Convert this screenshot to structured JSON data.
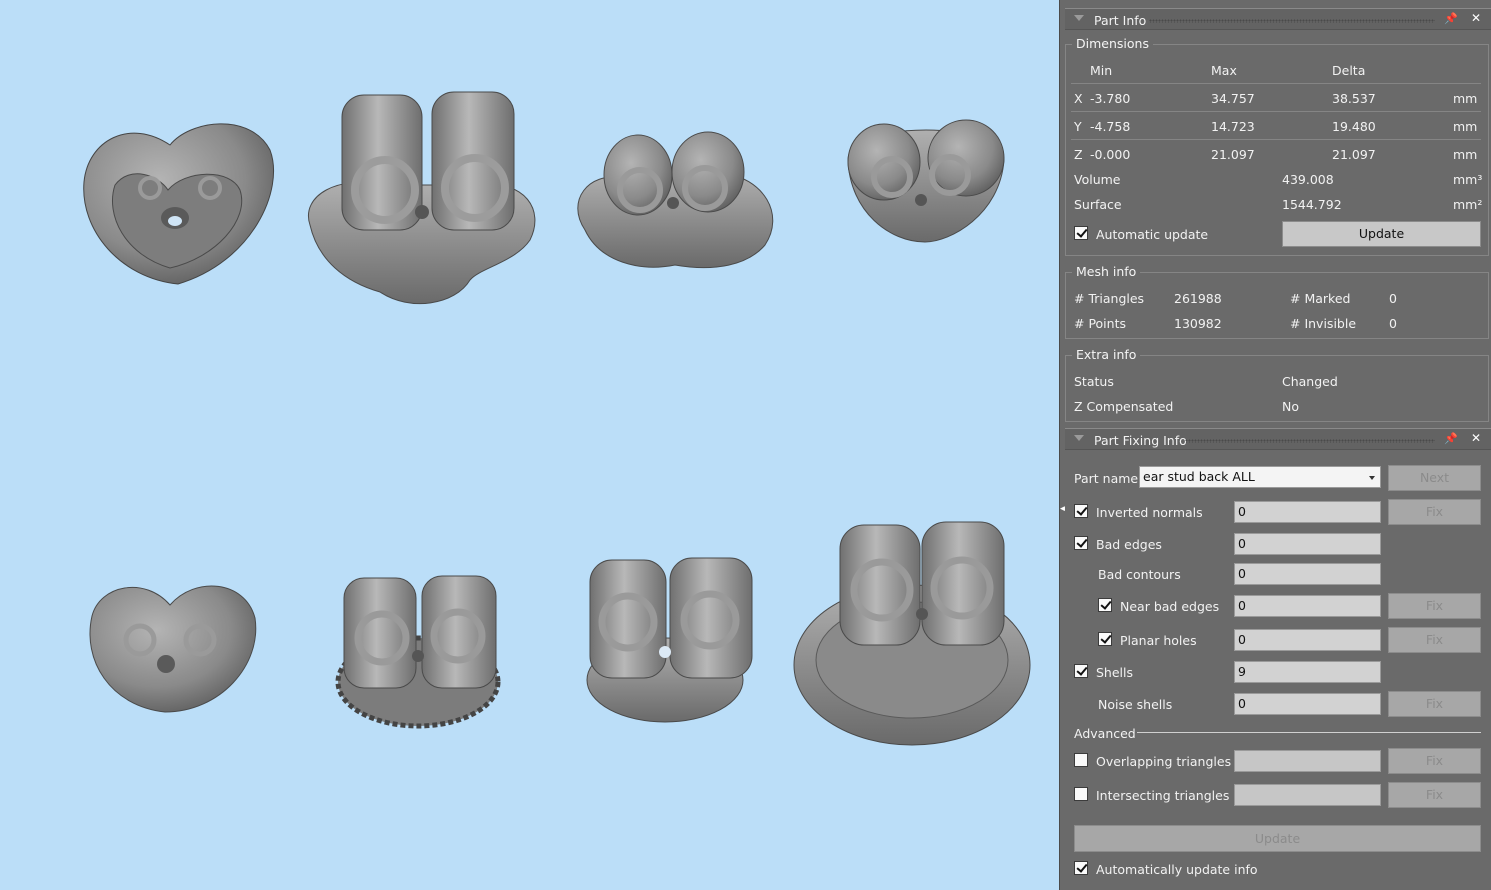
{
  "part_info": {
    "title": "Part Info",
    "dimensions": {
      "legend": "Dimensions",
      "headers": [
        "Min",
        "Max",
        "Delta"
      ],
      "rows": [
        {
          "axis": "X",
          "min": "-3.780",
          "max": "34.757",
          "delta": "38.537",
          "unit": "mm"
        },
        {
          "axis": "Y",
          "min": "-4.758",
          "max": "14.723",
          "delta": "19.480",
          "unit": "mm"
        },
        {
          "axis": "Z",
          "min": "-0.000",
          "max": "21.097",
          "delta": "21.097",
          "unit": "mm"
        }
      ],
      "volume_label": "Volume",
      "volume_value": "439.008",
      "volume_unit": "mm³",
      "surface_label": "Surface",
      "surface_value": "1544.792",
      "surface_unit": "mm²",
      "auto_update_label": "Automatic update",
      "update_button": "Update"
    },
    "mesh_info": {
      "legend": "Mesh info",
      "triangles_label": "# Triangles",
      "triangles_value": "261988",
      "marked_label": "# Marked",
      "marked_value": "0",
      "points_label": "# Points",
      "points_value": "130982",
      "invisible_label": "# Invisible",
      "invisible_value": "0"
    },
    "extra_info": {
      "legend": "Extra info",
      "status_label": "Status",
      "status_value": "Changed",
      "zcomp_label": "Z Compensated",
      "zcomp_value": "No"
    }
  },
  "part_fixing": {
    "title": "Part Fixing Info",
    "part_name_label": "Part name",
    "part_name_value": "ear stud back ALL",
    "next_button": "Next",
    "inverted_normals_label": "Inverted normals",
    "inverted_normals_value": "0",
    "bad_edges_label": "Bad edges",
    "bad_edges_value": "0",
    "bad_contours_label": "Bad contours",
    "bad_contours_value": "0",
    "near_bad_edges_label": "Near bad edges",
    "near_bad_edges_value": "0",
    "planar_holes_label": "Planar holes",
    "planar_holes_value": "0",
    "shells_label": "Shells",
    "shells_value": "9",
    "noise_shells_label": "Noise shells",
    "noise_shells_value": "0",
    "advanced_label": "Advanced",
    "overlapping_label": "Overlapping triangles",
    "intersecting_label": "Intersecting triangles",
    "fix_label": "Fix",
    "update_button": "Update",
    "auto_update_info_label": "Automatically update info"
  },
  "icons": {
    "pin": "📌",
    "close": "✕"
  },
  "colors": {
    "viewport_bg": "#bbdef8",
    "panel_bg": "#6a6a6a",
    "model_gray": "#8e8e8e"
  }
}
